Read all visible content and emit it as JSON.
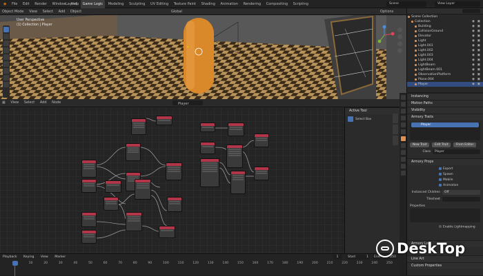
{
  "topbar": {
    "menus": [
      "File",
      "Edit",
      "Render",
      "Window",
      "Help"
    ],
    "workspace_tabs": [
      "Layout",
      "Game Logic",
      "Modeling",
      "Sculpting",
      "UV Editing",
      "Texture Paint",
      "Shading",
      "Animation",
      "Rendering",
      "Compositing",
      "Scripting"
    ],
    "active_tab": "Game Logic",
    "scene_label": "Scene",
    "view_layer_label": "View Layer"
  },
  "viewport": {
    "header_items": [
      "Object Mode",
      "View",
      "Select",
      "Add",
      "Object"
    ],
    "orientation": "Global",
    "options_label": "Options",
    "overlay_title": "User Perspective",
    "overlay_subtitle": "(1) Collection | Player",
    "accent_color": "#4772b3"
  },
  "outliner": {
    "items": [
      {
        "label": "Scene Collection",
        "depth": 0,
        "selected": false
      },
      {
        "label": "Collection",
        "depth": 1,
        "selected": false
      },
      {
        "label": "Building",
        "depth": 2,
        "selected": false
      },
      {
        "label": "CollisionGround",
        "depth": 2,
        "selected": false
      },
      {
        "label": "Elevator",
        "depth": 2,
        "selected": false
      },
      {
        "label": "Light",
        "depth": 2,
        "selected": false
      },
      {
        "label": "Light.001",
        "depth": 2,
        "selected": false
      },
      {
        "label": "Light.002",
        "depth": 2,
        "selected": false
      },
      {
        "label": "Light.003",
        "depth": 2,
        "selected": false
      },
      {
        "label": "Light.004",
        "depth": 2,
        "selected": false
      },
      {
        "label": "LightBeam",
        "depth": 2,
        "selected": false
      },
      {
        "label": "LightBeam.001",
        "depth": 2,
        "selected": false
      },
      {
        "label": "ObservationPlatform",
        "depth": 2,
        "selected": false
      },
      {
        "label": "Plane.004",
        "depth": 2,
        "selected": false
      },
      {
        "label": "Player",
        "depth": 2,
        "selected": true
      }
    ]
  },
  "node_editor": {
    "header_items": [
      "View",
      "Select",
      "Add",
      "Node"
    ],
    "tree_name": "Player"
  },
  "node_sidebar": {
    "panel": "Active Tool",
    "tool": "Select Box"
  },
  "properties": {
    "panels": [
      "Instancing",
      "Motion Paths",
      "Visibility",
      "Armory Traits"
    ],
    "trait_item": "Player",
    "buttons": [
      "New Trait",
      "Edit Trait",
      "From Editor"
    ],
    "class_label": "Class",
    "class_value": "Player",
    "props_panel": "Armory Props",
    "checkboxes": [
      "Export",
      "Spawn",
      "Mobile",
      "Animation"
    ],
    "instanced_children_label": "Instanced Children",
    "instanced_children_value": "Off",
    "tilesheet_label": "Tilesheet",
    "properties_label": "Properties",
    "lightmapping_label": "Enable Lightmapping",
    "lower_panels": [
      "Armory Lod",
      "Line Art",
      "Custom Properties"
    ]
  },
  "timeline": {
    "menus": [
      "Playback",
      "Keying",
      "View",
      "Marker"
    ],
    "current_frame": "1",
    "start_label": "Start",
    "start_value": "1",
    "end_label": "End",
    "end_value": "250",
    "ticks": [
      "0",
      "10",
      "20",
      "30",
      "40",
      "50",
      "60",
      "70",
      "80",
      "90",
      "100",
      "110",
      "120",
      "130",
      "140",
      "150",
      "160",
      "170",
      "180",
      "190",
      "200",
      "210",
      "220",
      "230",
      "240",
      "250"
    ]
  },
  "watermark": {
    "text": "DeskTop"
  }
}
